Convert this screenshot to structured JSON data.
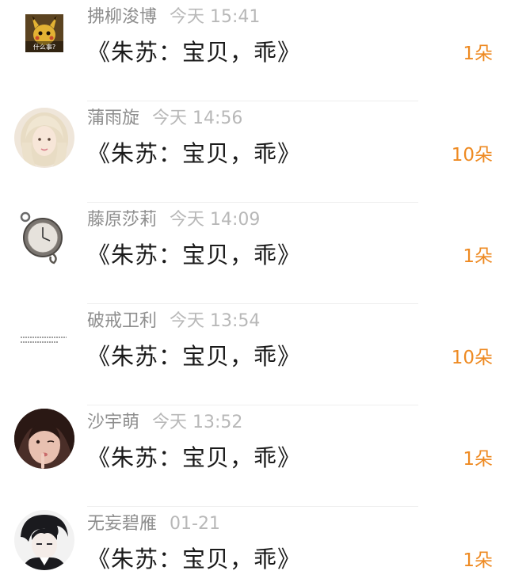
{
  "gifts": [
    {
      "user": "拂柳浚博",
      "time": "今天 15:41",
      "title": "《朱苏：宝贝，乖》",
      "count": "1朵",
      "avatar": "pikachu-avatar",
      "avatar_text": "什么事?"
    },
    {
      "user": "蒲雨旋",
      "time": "今天 14:56",
      "title": "《朱苏：宝贝，乖》",
      "count": "10朵",
      "avatar": "blonde-girl-avatar"
    },
    {
      "user": "藤原莎莉",
      "time": "今天 14:09",
      "title": "《朱苏：宝贝，乖》",
      "count": "1朵",
      "avatar": "pocket-watch-avatar"
    },
    {
      "user": "破戒卫利",
      "time": "今天 13:54",
      "title": "《朱苏：宝贝，乖》",
      "count": "10朵",
      "avatar": "text-avatar"
    },
    {
      "user": "沙宇萌",
      "time": "今天 13:52",
      "title": "《朱苏：宝贝，乖》",
      "count": "1朵",
      "avatar": "girl-selfie-avatar"
    },
    {
      "user": "无妄碧雁",
      "time": "01-21",
      "title": "《朱苏：宝贝，乖》",
      "count": "1朵",
      "avatar": "anime-boy-avatar"
    }
  ],
  "colors": {
    "count": "#ee8a22",
    "name": "#8e8e8e",
    "time": "#b8b8b8",
    "title": "#1a1a1a"
  }
}
